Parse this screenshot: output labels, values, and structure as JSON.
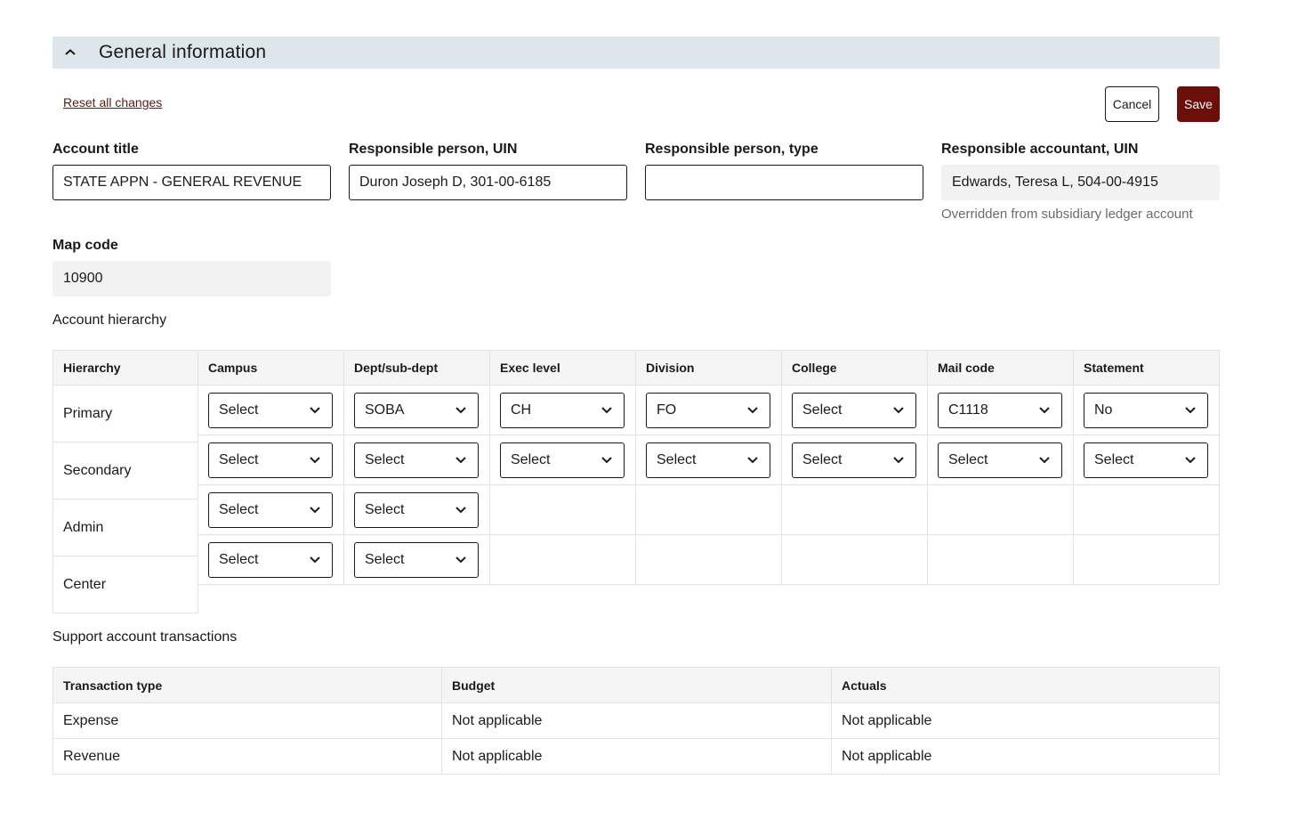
{
  "section": {
    "title": "General information",
    "chevron_icon": "chevron-up-icon"
  },
  "actions": {
    "reset_label": "Reset all changes",
    "cancel_label": "Cancel",
    "save_label": "Save"
  },
  "colors": {
    "header_bg": "#dce6eb",
    "save_bg": "#6b0f0a",
    "link": "#5a1a16"
  },
  "fields": {
    "account_title": {
      "label": "Account title",
      "value": "STATE APPN - GENERAL REVENUE"
    },
    "responsible_person_uin": {
      "label": "Responsible person, UIN",
      "value": "Duron Joseph D, 301-00-6185"
    },
    "responsible_person_type": {
      "label": "Responsible person, type",
      "value": ""
    },
    "responsible_accountant_uin": {
      "label": "Responsible accountant, UIN",
      "value": "Edwards, Teresa L, 504-00-4915",
      "helper": "Overridden from subsidiary ledger account"
    },
    "map_code": {
      "label": "Map code",
      "value": "10900"
    }
  },
  "hierarchy": {
    "heading": "Account hierarchy",
    "columns": [
      "Hierarchy",
      "Campus",
      "Dept/sub-dept",
      "Exec level",
      "Division",
      "College",
      "Mail code",
      "Statement"
    ],
    "rows": [
      {
        "label": "Primary",
        "values": [
          "Select",
          "SOBA",
          "CH",
          "FO",
          "Select",
          "C1118",
          "No"
        ]
      },
      {
        "label": "Secondary",
        "values": [
          "Select",
          "Select",
          "Select",
          "Select",
          "Select",
          "Select",
          "Select"
        ]
      },
      {
        "label": "Admin",
        "values": [
          "Select",
          "Select"
        ]
      },
      {
        "label": "Center",
        "values": [
          "Select",
          "Select"
        ]
      }
    ]
  },
  "transactions": {
    "heading": "Support account transactions",
    "columns": [
      "Transaction type",
      "Budget",
      "Actuals"
    ],
    "rows": [
      [
        "Expense",
        "Not applicable",
        "Not applicable"
      ],
      [
        "Revenue",
        "Not applicable",
        "Not applicable"
      ]
    ]
  }
}
